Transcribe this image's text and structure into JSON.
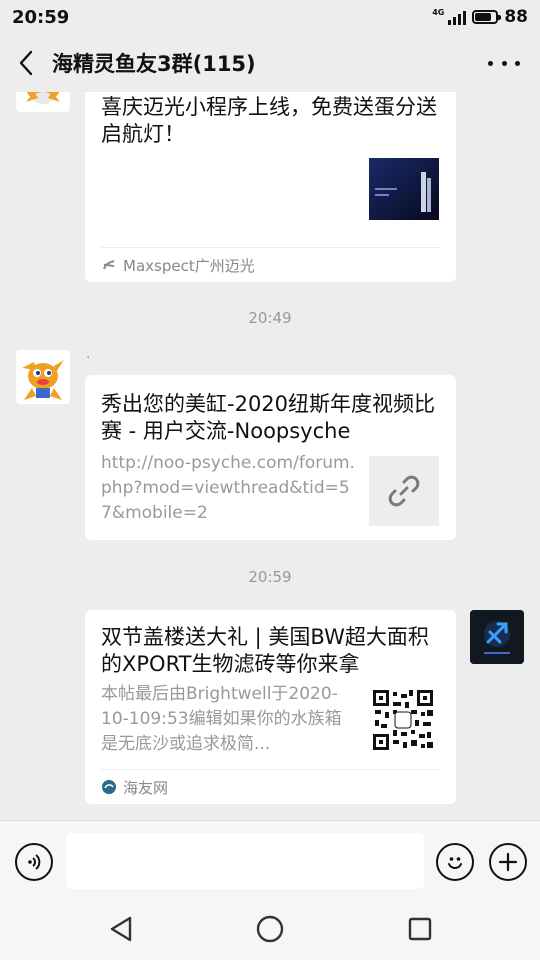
{
  "status_bar": {
    "time": "20:59",
    "network": "4G",
    "battery": "88",
    "battery_level": 0.88
  },
  "header": {
    "title": "海精灵鱼友3群(115)"
  },
  "messages": [
    {
      "type": "link-card",
      "title": "喜庆迈光小程序上线，免费送蛋分送启航灯！",
      "source": "Maxspect广州迈光"
    },
    {
      "type": "time",
      "text": "20:49"
    },
    {
      "type": "link-card",
      "sender": ".",
      "title": "秀出您的美缸-2020纽斯年度视频比赛 - 用户交流-Noopsyche",
      "desc": "http://noo-psyche.com/forum.php?mod=viewthread&tid=57&mobile=2",
      "icon": "link-icon"
    },
    {
      "type": "time",
      "text": "20:59"
    },
    {
      "type": "link-card",
      "title": "双节盖楼送大礼 | 美国BW超大面积的XPORT生物滤砖等你来拿",
      "desc": "本帖最后由Brightwell于2020-10-109:53编辑如果你的水族箱是无底沙或追求极简...",
      "source": "海友网"
    }
  ],
  "input_bar": {
    "placeholder": ""
  },
  "icons": [
    "back-icon",
    "more-icon",
    "voice-icon",
    "emoji-icon",
    "plus-icon",
    "nav-back-icon",
    "nav-home-icon",
    "nav-recent-icon"
  ]
}
